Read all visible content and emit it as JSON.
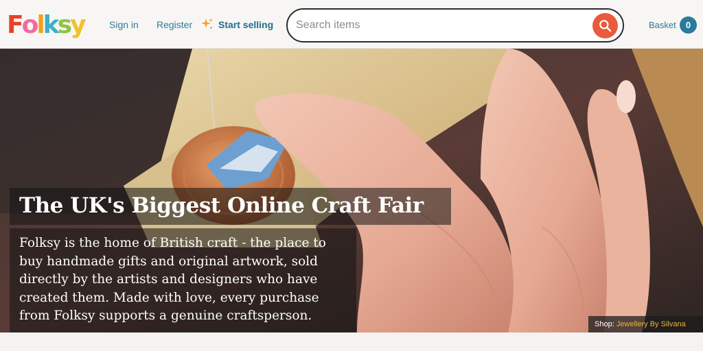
{
  "header": {
    "logo_text": "Folksy",
    "logo_letters": [
      {
        "char": "F",
        "color": "#e8412c"
      },
      {
        "char": "o",
        "color": "#f06ba3"
      },
      {
        "char": "l",
        "color": "#f3a21b"
      },
      {
        "char": "k",
        "color": "#3bb0c9"
      },
      {
        "char": "s",
        "color": "#8cc63e"
      },
      {
        "char": "y",
        "color": "#f2c02c"
      }
    ],
    "sign_in": "Sign in",
    "register": "Register",
    "start_selling": "Start selling",
    "search_placeholder": "Search items",
    "basket_label": "Basket",
    "basket_count": "0",
    "icons": {
      "sell": "sparkle-icon",
      "search": "search-icon"
    }
  },
  "hero": {
    "title": "The UK's Biggest Online Craft Fair",
    "description": "Folksy is the home of British craft - the place to buy handmade gifts and original artwork, sold directly by the artists and designers who have created them. Made with love, every purchase from Folksy supports a genuine craftsperson.",
    "shop_prefix": "Shop:",
    "shop_name": "Jewellery By Silvana"
  },
  "colors": {
    "accent_blue": "#2c7a9b",
    "search_button": "#ea5a3c",
    "shop_link": "#e6b53a"
  }
}
